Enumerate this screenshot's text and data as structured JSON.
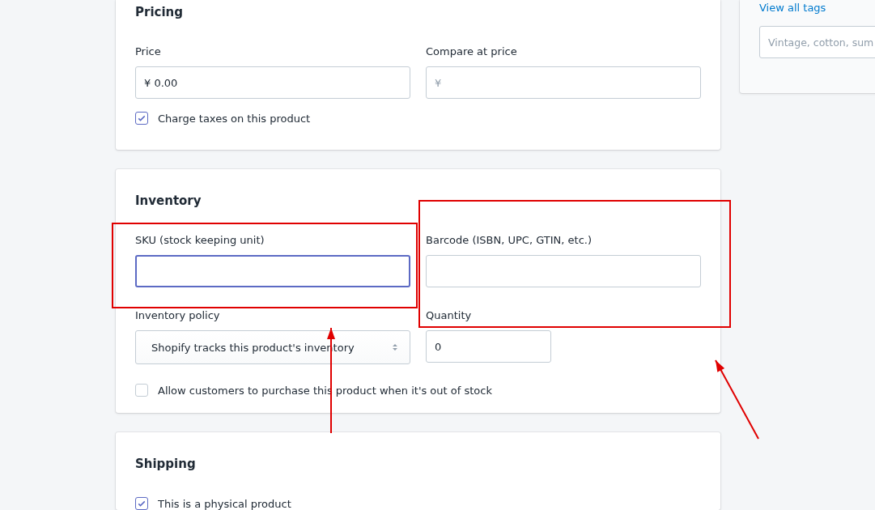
{
  "pricing": {
    "title": "Pricing",
    "fields": [
      {
        "label": "Price",
        "value": "¥ 0.00"
      },
      {
        "label": "Compare at price",
        "placeholder": "¥"
      }
    ],
    "charge_taxes": {
      "label": "Charge taxes on this product",
      "checked": true
    }
  },
  "inventory": {
    "title": "Inventory",
    "sku": {
      "label": "SKU (stock keeping unit)",
      "focused": true
    },
    "barcode": {
      "label": "Barcode (ISBN, UPC, GTIN, etc.)"
    },
    "policy": {
      "label": "Inventory policy",
      "value": "Shopify tracks this product's inventory"
    },
    "quantity": {
      "label": "Quantity",
      "value": "0"
    },
    "allow_oversell": {
      "label": "Allow customers to purchase this product when it's out of stock",
      "checked": false
    }
  },
  "shipping": {
    "title": "Shipping",
    "physical": {
      "label": "This is a physical product",
      "checked": true
    }
  },
  "tags": {
    "link": "View all tags",
    "placeholder": "Vintage, cotton, sum"
  },
  "annotations": [
    {
      "kind": "box"
    },
    {
      "kind": "box"
    },
    {
      "kind": "arrow"
    },
    {
      "kind": "arrow"
    }
  ]
}
